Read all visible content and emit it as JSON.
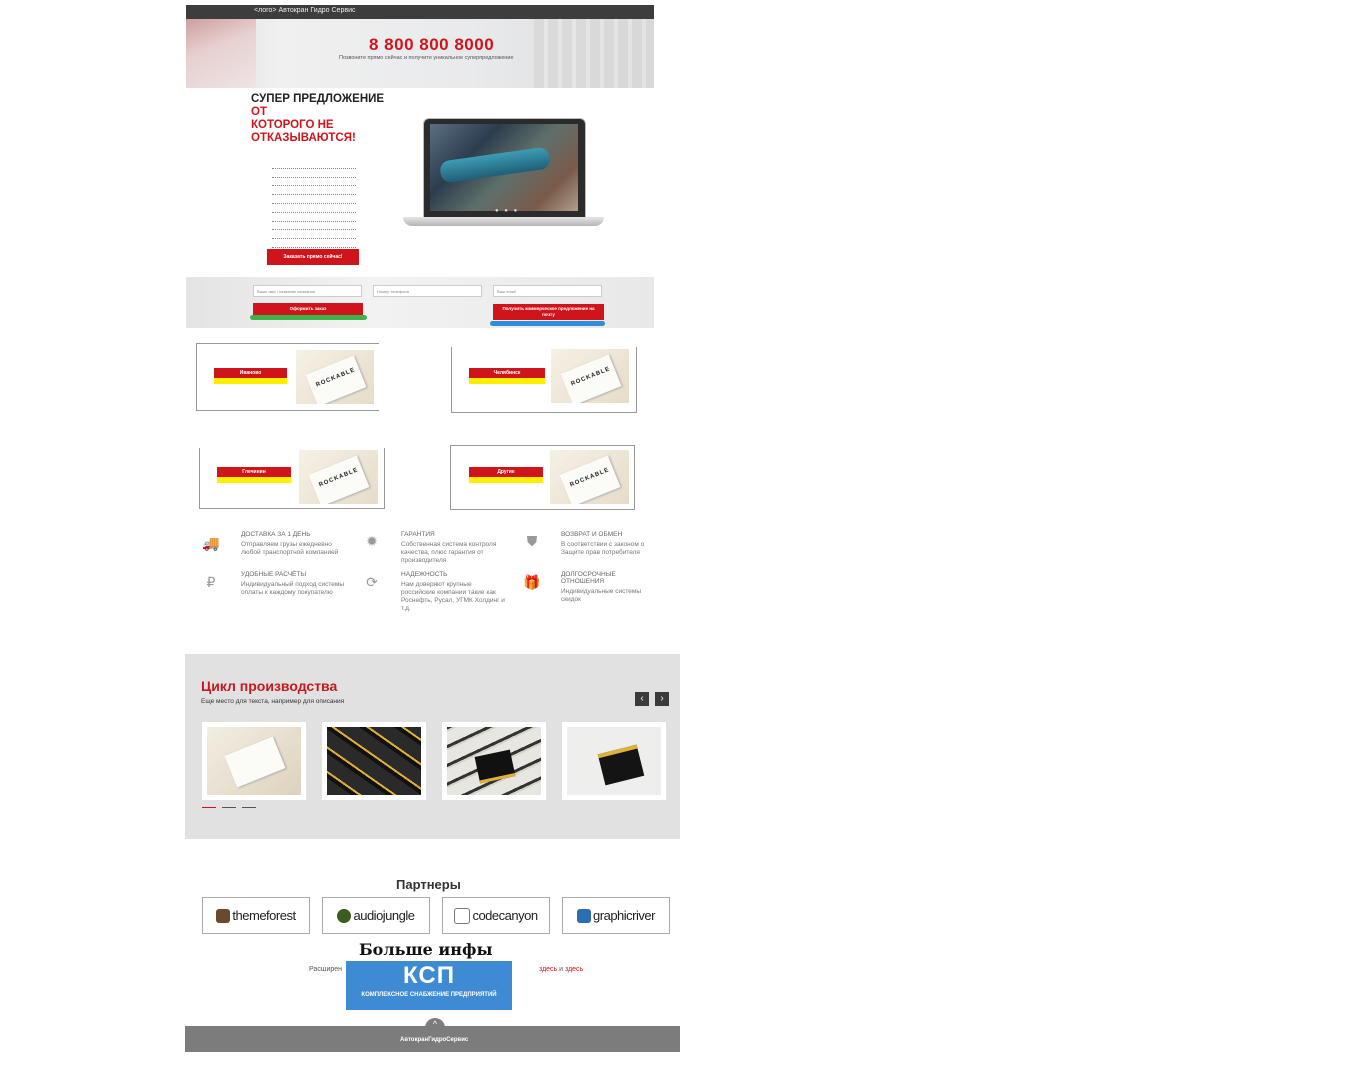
{
  "topbar": {
    "title": "<лого> Автокран Гидро Сервис"
  },
  "hero": {
    "phone": "8 800 800 8000",
    "subtitle": "Позвоните прямо сейчас и получите уникальное суперпредложение"
  },
  "offer": {
    "title_black": "СУПЕР ПРЕДЛОЖЕНИЕ ",
    "title_red_1": "ОТ",
    "title_red_2": "КОТОРОГО НЕ ОТКАЗЫВАЮТСЯ!"
  },
  "order_button": "Заказать прямо сейчас!",
  "form": {
    "name_placeholder": "Ваше имя / название компании",
    "phone_placeholder": "Номер телефона",
    "email_placeholder": "Ваш email",
    "submit_label": "Оформить заказ",
    "offer_label": "Получить коммерческое предложение на почту"
  },
  "cities": [
    {
      "label": "Иваново"
    },
    {
      "label": "Челябинск"
    },
    {
      "label": "Глечинин"
    },
    {
      "label": "Другие"
    }
  ],
  "card_text": "ROCKABLE",
  "features": [
    {
      "icon": "truck-icon",
      "title": "ДОСТАВКА ЗА 1 ДЕНЬ",
      "desc": "Отправляем грузы ежедневно любой транспортной компанией"
    },
    {
      "icon": "award-icon",
      "title": "ГАРАНТИЯ",
      "desc": "Собственная система контроля качества, плюс гарантия от производителя"
    },
    {
      "icon": "shield-icon",
      "title": "ВОЗВРАТ И ОБМЕН",
      "desc": "В соответствии с законом о Защите прав потребителя"
    },
    {
      "icon": "ruble-bag-icon",
      "title": "УДОБНЫЕ РАСЧЁТЫ",
      "desc": "Индивидуальный подход системы оплаты к каждому покупателю"
    },
    {
      "icon": "refresh-icon",
      "title": "НАДЕЖНОСТЬ",
      "desc": "Нам доверяют крупные российские компании такие как Роснефть, Русал, УГМК Холдинг и т.д."
    },
    {
      "icon": "gift-icon",
      "title": "ДОЛГОСРОЧНЫЕ ОТНОШЕНИЯ",
      "desc": "Индивидуальные системы скидок"
    }
  ],
  "production": {
    "title": "Цикл производства",
    "subtitle": "Еще место для текста, например для описания",
    "prev": "‹",
    "next": "›"
  },
  "partners": {
    "title": "Партнеры",
    "items": [
      {
        "name": "themeforest",
        "color": "#6a4a2a"
      },
      {
        "name": "audiojungle",
        "color": "#3d5c1f"
      },
      {
        "name": "codecanyon",
        "color": "#777777"
      },
      {
        "name": "graphicriver",
        "color": "#2b6fb0"
      }
    ]
  },
  "more": {
    "title": "Больше инфы",
    "text_prefix": "Расширен",
    "link1": "здесь",
    "and": " и ",
    "link2": "здесь"
  },
  "ksp": {
    "big": "КСП",
    "small": "КОМПЛЕКСНОЕ СНАБЖЕНИЕ ПРЕДПРИЯТИЙ"
  },
  "footer": {
    "company": "АвтокранГидроСервис",
    "up": "^"
  }
}
